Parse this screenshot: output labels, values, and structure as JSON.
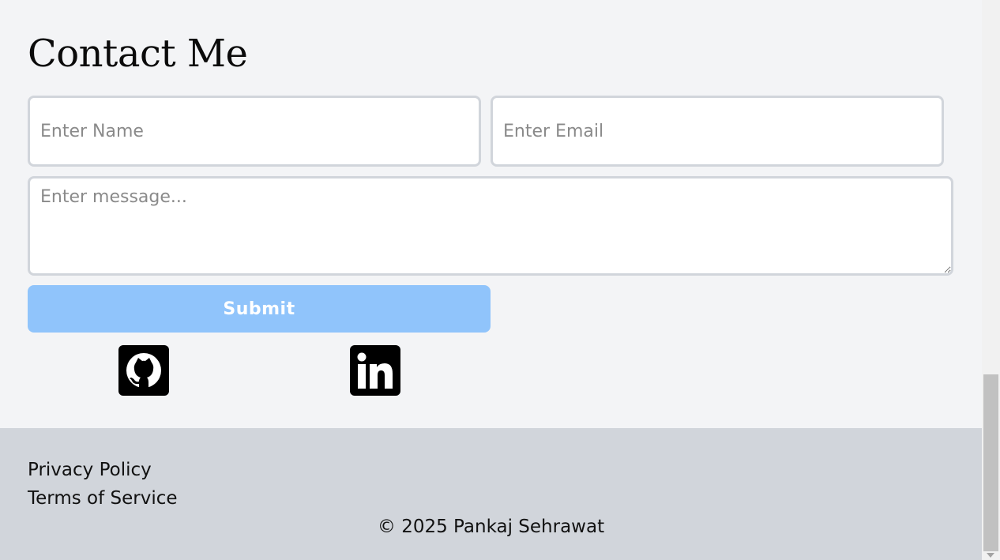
{
  "contact": {
    "title": "Contact Me",
    "name_placeholder": "Enter Name",
    "email_placeholder": "Enter Email",
    "message_placeholder": "Enter message...",
    "submit_label": "Submit",
    "submit_color": "#90c4fb",
    "social": [
      {
        "icon": "github-icon"
      },
      {
        "icon": "linkedin-icon"
      }
    ]
  },
  "footer": {
    "links": [
      "Privacy Policy",
      "Terms of Service"
    ],
    "copyright": "© 2025 Pankaj Sehrawat",
    "background": "#d1d5db"
  }
}
